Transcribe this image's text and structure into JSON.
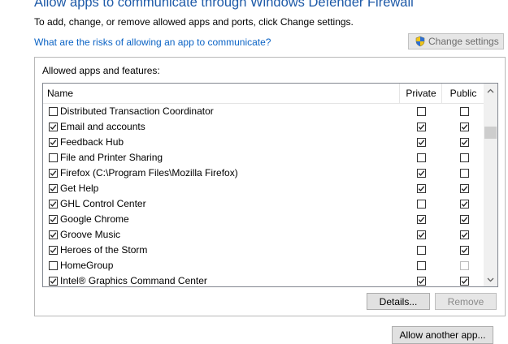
{
  "page": {
    "title": "Allow apps to communicate through Windows Defender Firewall",
    "subtitle": "To add, change, or remove allowed apps and ports, click Change settings.",
    "risk_link": "What are the risks of allowing an app to communicate?",
    "change_settings_label": "Change settings"
  },
  "group": {
    "label": "Allowed apps and features:",
    "columns": {
      "name": "Name",
      "private": "Private",
      "public": "Public"
    }
  },
  "apps": [
    {
      "name": "Distributed Transaction Coordinator",
      "enabled": false,
      "private": false,
      "public": false
    },
    {
      "name": "Email and accounts",
      "enabled": true,
      "private": true,
      "public": true
    },
    {
      "name": "Feedback Hub",
      "enabled": true,
      "private": true,
      "public": true
    },
    {
      "name": "File and Printer Sharing",
      "enabled": false,
      "private": false,
      "public": false
    },
    {
      "name": "Firefox (C:\\Program Files\\Mozilla Firefox)",
      "enabled": true,
      "private": true,
      "public": false
    },
    {
      "name": "Get Help",
      "enabled": true,
      "private": true,
      "public": true
    },
    {
      "name": "GHL Control Center",
      "enabled": true,
      "private": false,
      "public": true
    },
    {
      "name": "Google Chrome",
      "enabled": true,
      "private": true,
      "public": true
    },
    {
      "name": "Groove Music",
      "enabled": true,
      "private": true,
      "public": true
    },
    {
      "name": "Heroes of the Storm",
      "enabled": true,
      "private": false,
      "public": true
    },
    {
      "name": "HomeGroup",
      "enabled": false,
      "private": false,
      "public": false,
      "public_disabled": true
    },
    {
      "name": "Intel® Graphics Command Center",
      "enabled": true,
      "private": true,
      "public": true
    }
  ],
  "scrollbar": {
    "position": 0.18,
    "visible_fraction": 0.07
  },
  "buttons": {
    "details": "Details...",
    "remove": "Remove",
    "allow_another": "Allow another app..."
  },
  "colors": {
    "title": "#1e5aa8",
    "link": "#0b63c5"
  },
  "icons": {
    "shield": "uac-shield-icon",
    "scroll_up": "chevron-up-icon",
    "scroll_down": "chevron-down-icon"
  }
}
